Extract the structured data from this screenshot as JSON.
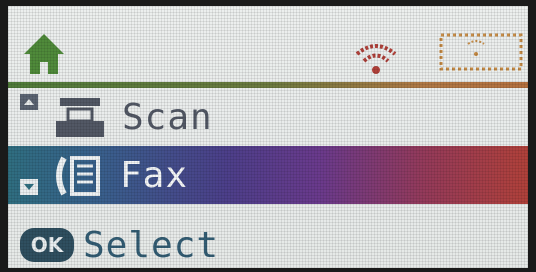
{
  "header": {
    "home_icon": "home-icon",
    "wifi_icon": "wifi-icon",
    "status_icon": "wifi-direct-status-icon"
  },
  "menu": {
    "items": [
      {
        "label": "Scan",
        "icon": "scanner-icon",
        "selected": false
      },
      {
        "label": "Fax",
        "icon": "fax-icon",
        "selected": true
      }
    ],
    "scroll_up_icon": "arrow-up-icon",
    "scroll_down_icon": "arrow-down-icon"
  },
  "footer": {
    "ok_label": "OK",
    "action_label": "Select"
  },
  "colors": {
    "accent_green": "#4f7b3a",
    "accent_orange": "#b4703e",
    "selection_start": "#2f6e80",
    "selection_end": "#b0413a",
    "text_dark": "#525865",
    "text_select": "#335d74"
  }
}
